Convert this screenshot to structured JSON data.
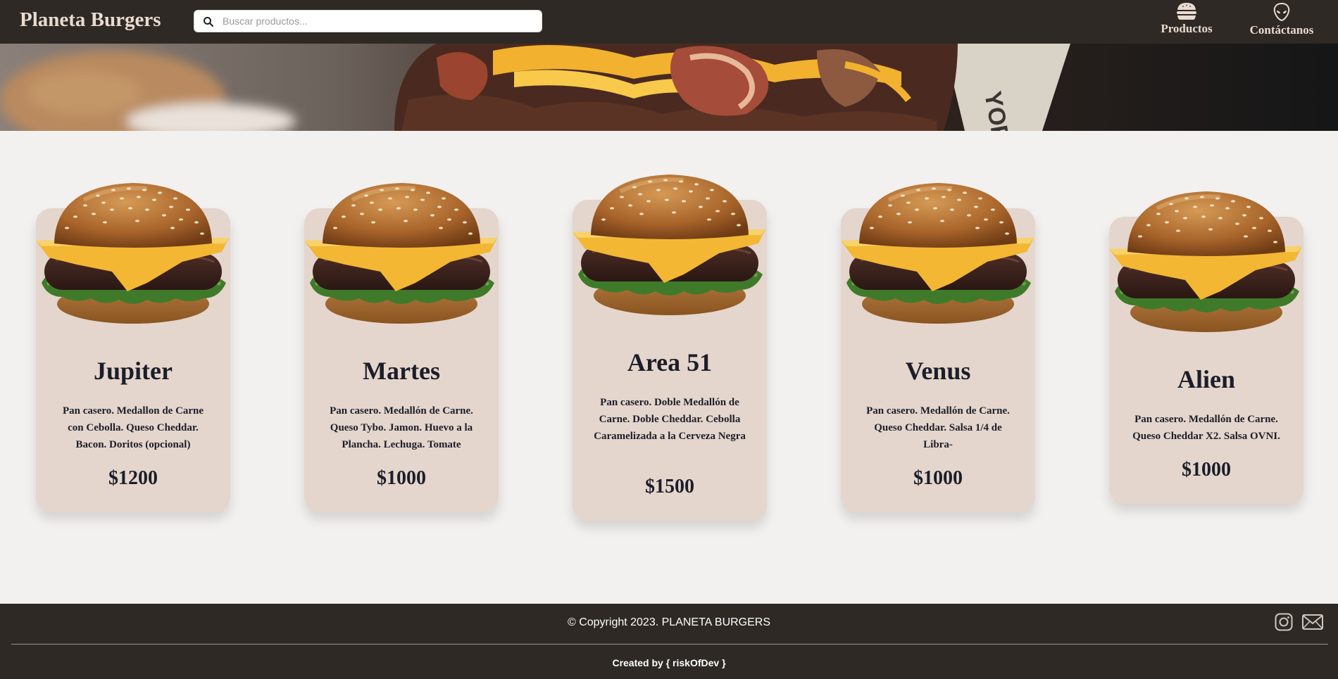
{
  "header": {
    "brand": "Planeta Burgers",
    "search_placeholder": "Buscar productos...",
    "nav": [
      {
        "label": "Productos",
        "icon": "burger-icon"
      },
      {
        "label": "Contáctanos",
        "icon": "alien-icon"
      }
    ]
  },
  "products": [
    {
      "name": "Jupiter",
      "description": "Pan casero. Medallon de Carne con Cebolla. Queso Cheddar. Bacon. Doritos (opcional)",
      "price": "$1200"
    },
    {
      "name": "Martes",
      "description": "Pan casero. Medallón de Carne. Queso Tybo. Jamon. Huevo a la Plancha. Lechuga. Tomate",
      "price": "$1000"
    },
    {
      "name": "Area 51",
      "description": "Pan casero. Doble Medallón de Carne. Doble Cheddar. Cebolla Caramelizada a la Cerveza Negra",
      "price": "$1500"
    },
    {
      "name": "Venus",
      "description": "Pan casero. Medallón de Carne. Queso Cheddar. Salsa 1/4 de Libra-",
      "price": "$1000"
    },
    {
      "name": "Alien",
      "description": "Pan casero. Medallón de Carne. Queso Cheddar X2. Salsa OVNI.",
      "price": "$1000"
    }
  ],
  "footer": {
    "copyright": "© Copyright 2023. PLANETA BURGERS",
    "credit": "Created by { riskOfDev }",
    "social": [
      "instagram-icon",
      "mail-icon"
    ]
  },
  "colors": {
    "nav_bg": "#2e2924",
    "brand_text": "#eadbd1",
    "card_bg": "#e4d6cc",
    "page_bg": "#f3f1ef"
  }
}
